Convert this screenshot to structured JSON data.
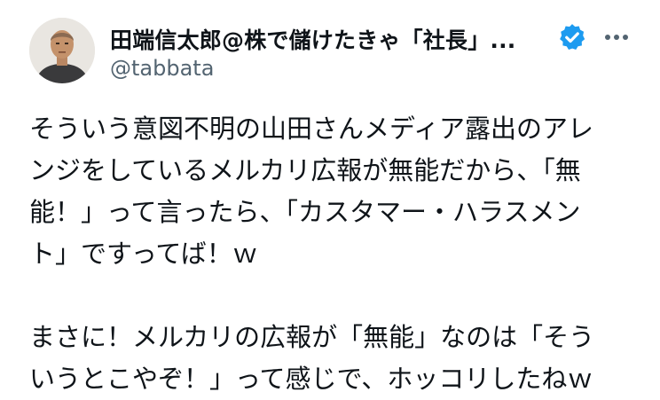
{
  "author": {
    "display_name": "田端信太郎@株で儲けたきゃ「社長」...",
    "handle": "@tabbata"
  },
  "tweet": {
    "lines_para1": [
      "そういう意図不明の山田さんメディア露出のアレ",
      "ンジをしているメルカリ広報が無能だから、「無",
      "能！」って言ったら、「カスタマー・ハラスメン",
      "ト」ですってば！ｗ"
    ],
    "lines_para2": [
      "まさに！メルカリの広報が「無能」なのは「そう",
      "いうとこやぞ！」って感じで、ホッコリしたねｗ"
    ]
  },
  "icons": {
    "verified": "verified-badge-icon",
    "more": "more-options-icon"
  },
  "colors": {
    "text": "#0f1419",
    "secondary_text": "#536471",
    "verified_blue": "#1d9bf0"
  }
}
